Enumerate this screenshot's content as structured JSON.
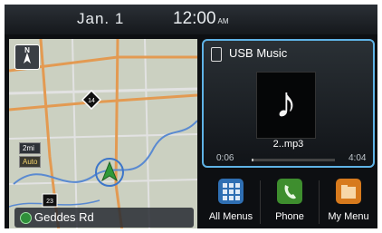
{
  "status": {
    "date": "Jan.  1",
    "time": "12:00",
    "ampm": "AM"
  },
  "map": {
    "compass_label": "N",
    "scale_distance": "2mi",
    "scale_mode": "Auto",
    "route_shield_1": "14",
    "route_shield_2": "23",
    "street_name": "Geddes Rd"
  },
  "music": {
    "source_title": "USB Music",
    "file_name": "2..mp3",
    "elapsed": "0:06",
    "duration": "4:04",
    "progress_fraction": 0.025,
    "album_art_glyph": "♪"
  },
  "dock": {
    "items": [
      {
        "label": "All Menus",
        "icon": "grid-icon",
        "color": "#2f6fb3"
      },
      {
        "label": "Phone",
        "icon": "phone-icon",
        "color": "#3e8e2e"
      },
      {
        "label": "My Menu",
        "icon": "folder-icon",
        "color": "#d77a1d"
      }
    ]
  },
  "colors": {
    "accent": "#5fb3e6",
    "map_bg": "#cbd0c1",
    "vehicle_marker": "#2f9a3a"
  }
}
